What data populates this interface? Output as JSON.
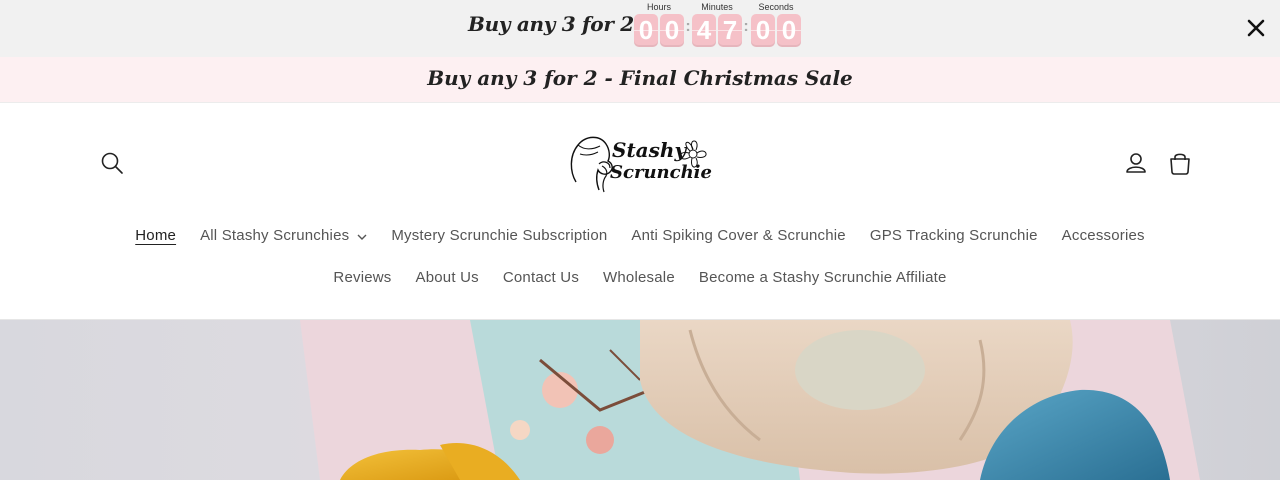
{
  "promo_bar": {
    "text": "Buy any 3 for 2!!",
    "timer": {
      "hours_label": "Hours",
      "minutes_label": "Minutes",
      "seconds_label": "Seconds",
      "hours": [
        "0",
        "0"
      ],
      "minutes": [
        "4",
        "7"
      ],
      "seconds": [
        "0",
        "0"
      ]
    },
    "close_icon": "close-icon"
  },
  "announcement": {
    "text": "Buy any 3 for 2 - Final Christmas Sale"
  },
  "header": {
    "logo": {
      "line1": "Stashy",
      "line2": "Scrunchie"
    },
    "icons": [
      "search-icon",
      "account-icon",
      "cart-icon"
    ],
    "nav_row1": [
      {
        "label": "Home",
        "active": true
      },
      {
        "label": "All Stashy Scrunchies",
        "dropdown": true
      },
      {
        "label": "Mystery Scrunchie Subscription"
      },
      {
        "label": "Anti Spiking Cover & Scrunchie"
      },
      {
        "label": "GPS Tracking Scrunchie"
      },
      {
        "label": "Accessories"
      }
    ],
    "nav_row2": [
      {
        "label": "Reviews"
      },
      {
        "label": "About Us"
      },
      {
        "label": "Contact Us"
      },
      {
        "label": "Wholesale"
      },
      {
        "label": "Become a Stashy Scrunchie Affiliate"
      }
    ]
  },
  "colors": {
    "promo_bg": "#f1f1f1",
    "announcement_bg": "#fdf0f2",
    "timer_digit_bg": "#f5c1c8"
  }
}
